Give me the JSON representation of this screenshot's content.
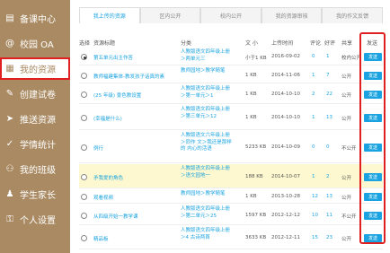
{
  "sidebar": {
    "items": [
      {
        "label": "备课中心",
        "icon": "book-icon"
      },
      {
        "label": "校园 OA",
        "icon": "at-icon"
      },
      {
        "label": "我的资源",
        "icon": "grid-icon",
        "active": true
      },
      {
        "label": "创建试卷",
        "icon": "edit-icon"
      },
      {
        "label": "推送资源",
        "icon": "push-icon"
      },
      {
        "label": "学情统计",
        "icon": "check-icon"
      },
      {
        "label": "我的班级",
        "icon": "class-icon"
      },
      {
        "label": "学生家长",
        "icon": "person-icon"
      },
      {
        "label": "个人设置",
        "icon": "key-icon"
      }
    ]
  },
  "tabs": [
    {
      "label": "我上传的资源",
      "active": true
    },
    {
      "label": "区内公开"
    },
    {
      "label": "校内公开"
    },
    {
      "label": "我的资源审核"
    },
    {
      "label": "我的作文反馈"
    }
  ],
  "table": {
    "headers": {
      "select": "选择",
      "name": "资源标题",
      "category": "分类",
      "size": "文 小",
      "time": "上传时间",
      "comments": "评论",
      "favorites": "好评",
      "share": "共享",
      "send": "发送"
    },
    "rows": [
      {
        "selected": true,
        "name": "第五单元出主作答",
        "category": "人教版语文四年级上册＞两单元三",
        "size": "小于1 KB",
        "time": "2016-09-02",
        "comments": "0",
        "favorites": "1",
        "share": "校内公开",
        "send": "发送"
      },
      {
        "selected": false,
        "name": "教师福建集体-教发孩子话真的素",
        "category": "教师园地＞教学随笔",
        "size": "1 KB",
        "time": "2014-11-06",
        "comments": "1",
        "favorites": "7",
        "share": "公开",
        "send": "发送"
      },
      {
        "selected": false,
        "name": "(25 年级) 景色教设置",
        "category": "人教版语文四年级上册＞第一单元＞1",
        "size": "1 KB",
        "time": "2014-10-10",
        "comments": "2",
        "favorites": "22",
        "share": "公开",
        "send": "发送"
      },
      {
        "selected": false,
        "name": "(幸福是什么)",
        "category": "人教版语文四年级上册＞第三单元＞12",
        "size": "1 KB",
        "time": "2014-10-10",
        "comments": "1",
        "favorites": "13",
        "share": "公开",
        "send": "发送"
      },
      {
        "selected": false,
        "name": "例行",
        "category": "人教版语文六年级上册＞同作 文＞我还是那样的 内心的活语",
        "size": "5233 KB",
        "time": "2014-10-09",
        "comments": "0",
        "favorites": "0",
        "share": "不公开",
        "send": "发送"
      },
      {
        "selected": false,
        "name": "矛我爱的角色",
        "category": "人教版语文四年级上册＞语文园地一",
        "size": "188 KB",
        "time": "2014-10-07",
        "comments": "1",
        "favorites": "2",
        "share": "公开",
        "send": "发送",
        "highlight": true
      },
      {
        "selected": false,
        "name": "观看视频",
        "category": "教师园地＞教学随笔",
        "size": "1 KB",
        "time": "2013-10-28",
        "comments": "12",
        "favorites": "13",
        "share": "公开",
        "send": "发送"
      },
      {
        "selected": false,
        "name": "从四级开始一教学课",
        "category": "人教版语文四年级上册＞第二单元＞25",
        "size": "1597 KB",
        "time": "2012-12-12",
        "comments": "10",
        "favorites": "11",
        "share": "不公开",
        "send": "发送"
      },
      {
        "selected": false,
        "name": "精品板",
        "category": "人教版语文四年级上册＞4 古诗两首",
        "size": "3633 KB",
        "time": "2012-12-11",
        "comments": "15",
        "favorites": "23",
        "share": "公开",
        "send": "发送"
      }
    ]
  },
  "colors": {
    "sidebar": "#a98a62",
    "accent": "#1aa3e0",
    "highlight": "#e02020",
    "row_highlight": "#fdf8cf"
  }
}
